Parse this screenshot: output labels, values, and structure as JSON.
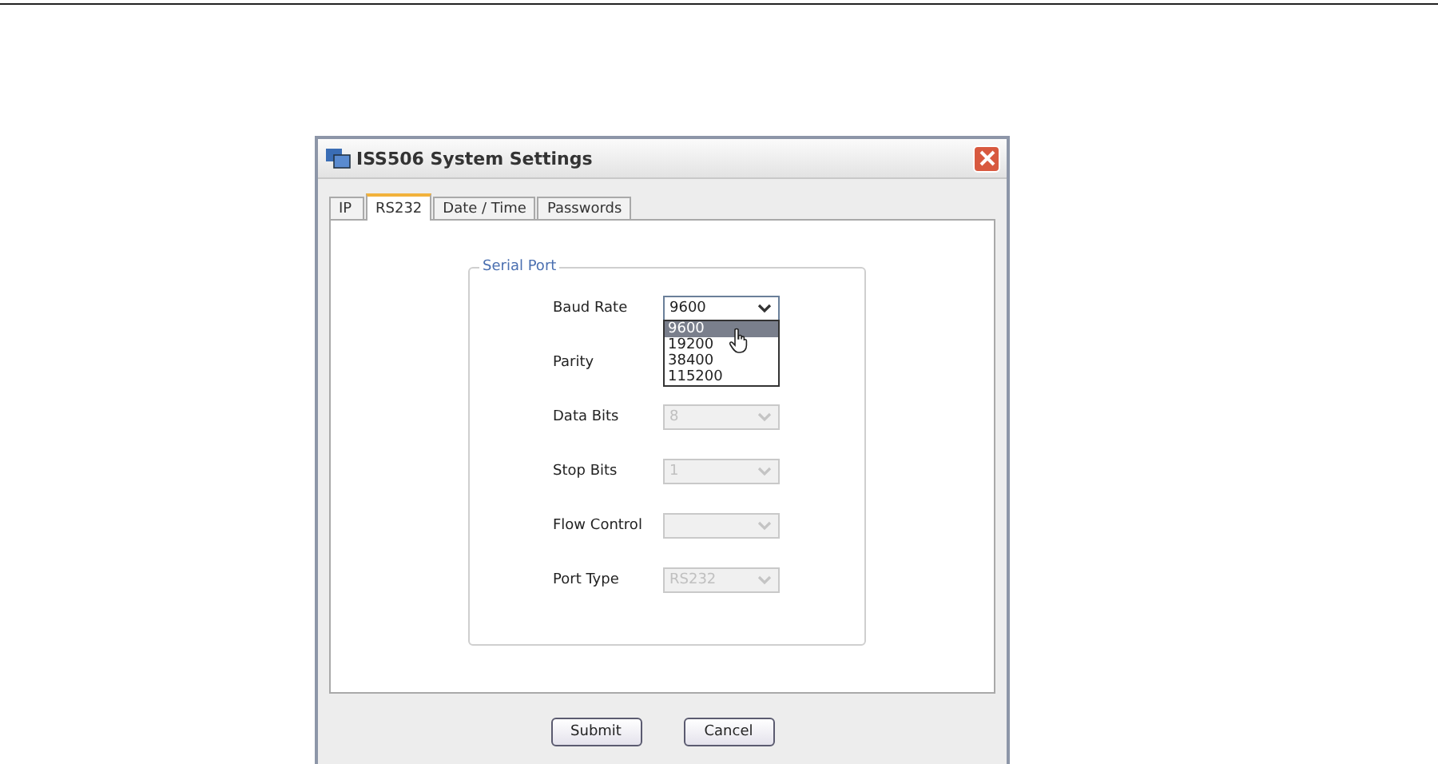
{
  "window": {
    "title": "ISS506 System Settings"
  },
  "tabs": [
    {
      "label": "IP",
      "selected": false
    },
    {
      "label": "RS232",
      "selected": true
    },
    {
      "label": "Date / Time",
      "selected": false
    },
    {
      "label": "Passwords",
      "selected": false
    }
  ],
  "group": {
    "title": "Serial Port"
  },
  "fields": [
    {
      "label": "Baud Rate",
      "value": "9600",
      "disabled": false,
      "expanded": true,
      "options": [
        {
          "label": "9600",
          "selected": true
        },
        {
          "label": "19200",
          "selected": false
        },
        {
          "label": "38400",
          "selected": false
        },
        {
          "label": "115200",
          "selected": false
        }
      ]
    },
    {
      "label": "Parity"
    },
    {
      "label": "Data Bits",
      "value": "8",
      "disabled": true
    },
    {
      "label": "Stop Bits",
      "value": "1",
      "disabled": true
    },
    {
      "label": "Flow Control",
      "disabled": true
    },
    {
      "label": "Port Type",
      "value": "RS232",
      "disabled": true
    }
  ],
  "buttons": [
    "Submit",
    "Cancel"
  ]
}
